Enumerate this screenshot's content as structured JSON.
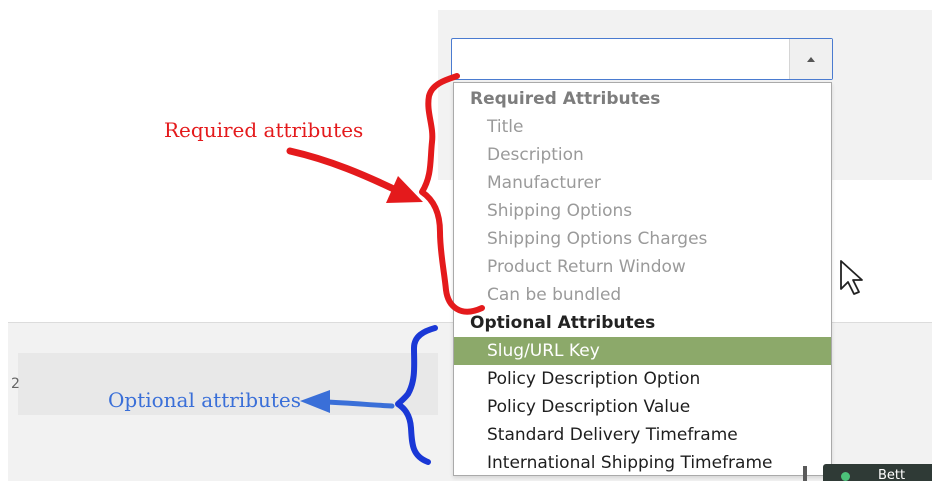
{
  "dropdown": {
    "selected_value": "",
    "groups": [
      {
        "label": "Required Attributes",
        "disabled": true,
        "options": [
          "Title",
          "Description",
          "Manufacturer",
          "Shipping Options",
          "Shipping Options Charges",
          "Product Return Window",
          "Can be bundled"
        ]
      },
      {
        "label": "Optional Attributes",
        "disabled": false,
        "options": [
          "Slug/URL Key",
          "Policy Description Option",
          "Policy Description Value",
          "Standard Delivery Timeframe",
          "International Shipping Timeframe"
        ]
      }
    ],
    "highlighted_option": "Slug/URL Key"
  },
  "annotations": {
    "required_label": "Required attributes",
    "optional_label": "Optional attributes"
  },
  "background": {
    "cut_digit": "2",
    "corner_button_text": "Bett"
  },
  "colors": {
    "select_border": "#4a7bd0",
    "highlight_bg": "#8ca96a",
    "required_annotation": "#e41a1c",
    "optional_annotation": "#3a6fd8"
  },
  "icons": {
    "select_arrow": "chevron-up-icon",
    "cursor": "mouse-pointer-icon",
    "status_dot": "status-dot-icon"
  }
}
